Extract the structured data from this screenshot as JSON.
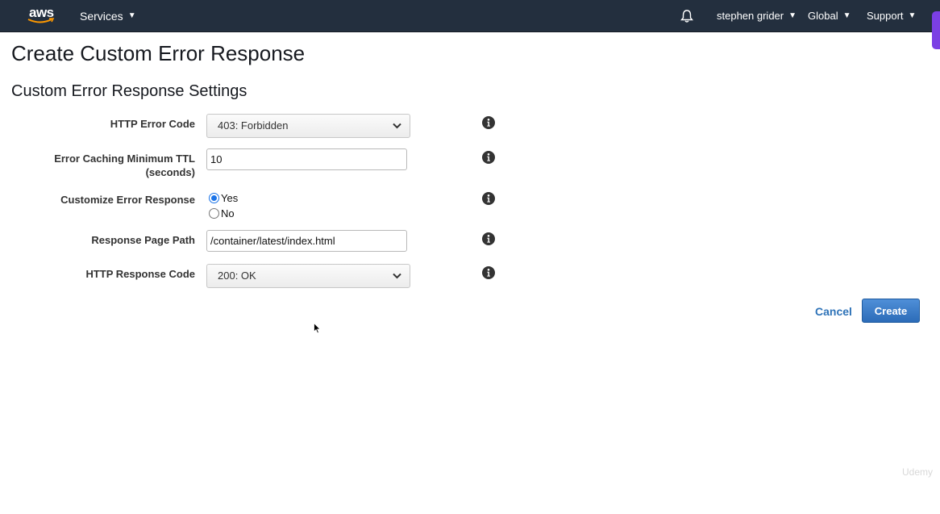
{
  "nav": {
    "logo": "aws",
    "services": "Services",
    "user": "stephen grider",
    "region": "Global",
    "support": "Support",
    "caret": "▼"
  },
  "page": {
    "title": "Create Custom Error Response",
    "section_title": "Custom Error Response Settings"
  },
  "form": {
    "http_error_code": {
      "label": "HTTP Error Code",
      "selected": "403: Forbidden"
    },
    "error_caching_ttl": {
      "label": "Error Caching Minimum TTL (seconds)",
      "value": "10"
    },
    "customize_error_response": {
      "label": "Customize Error Response",
      "options": [
        {
          "label": "Yes",
          "checked": true
        },
        {
          "label": "No",
          "checked": false
        }
      ]
    },
    "response_page_path": {
      "label": "Response Page Path",
      "value": "/container/latest/index.html"
    },
    "http_response_code": {
      "label": "HTTP Response Code",
      "selected": "200: OK"
    }
  },
  "actions": {
    "cancel": "Cancel",
    "create": "Create"
  },
  "watermark": "Udemy",
  "colors": {
    "nav_bg": "#232f3e",
    "accent_blue": "#2e73b8",
    "aws_orange": "#ff9900"
  }
}
